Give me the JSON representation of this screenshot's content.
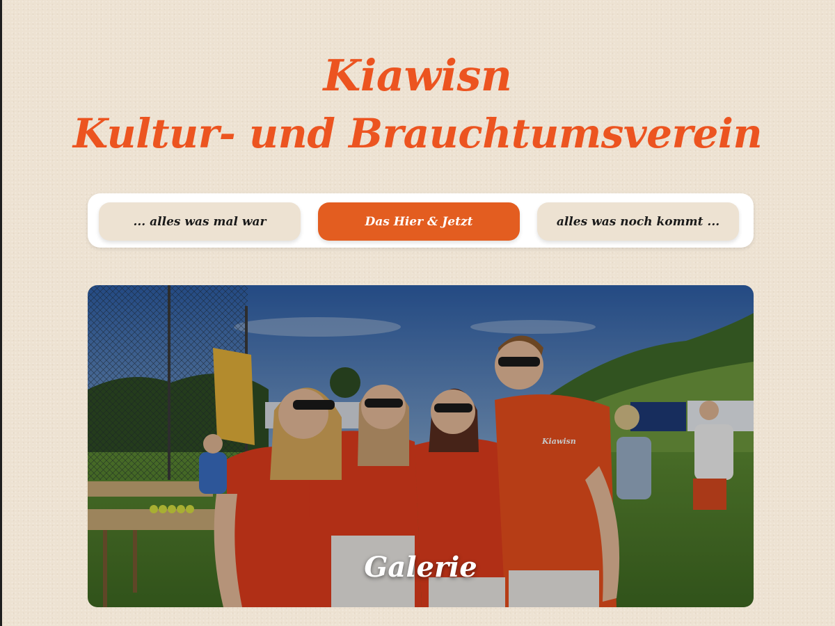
{
  "header": {
    "title": "Kiawisn",
    "subtitle": "Kultur- und Brauchtumsverein"
  },
  "nav": {
    "items": [
      {
        "label": "... alles was mal war",
        "active": false
      },
      {
        "label": "Das Hier & Jetzt",
        "active": true
      },
      {
        "label": "alles was noch kommt ...",
        "active": false
      }
    ]
  },
  "gallery": {
    "label": "Galerie",
    "shirt_print": "Kiawisn"
  },
  "colors": {
    "accent": "#ec5420",
    "active_button": "#e35d20",
    "background": "#ede2d2"
  }
}
